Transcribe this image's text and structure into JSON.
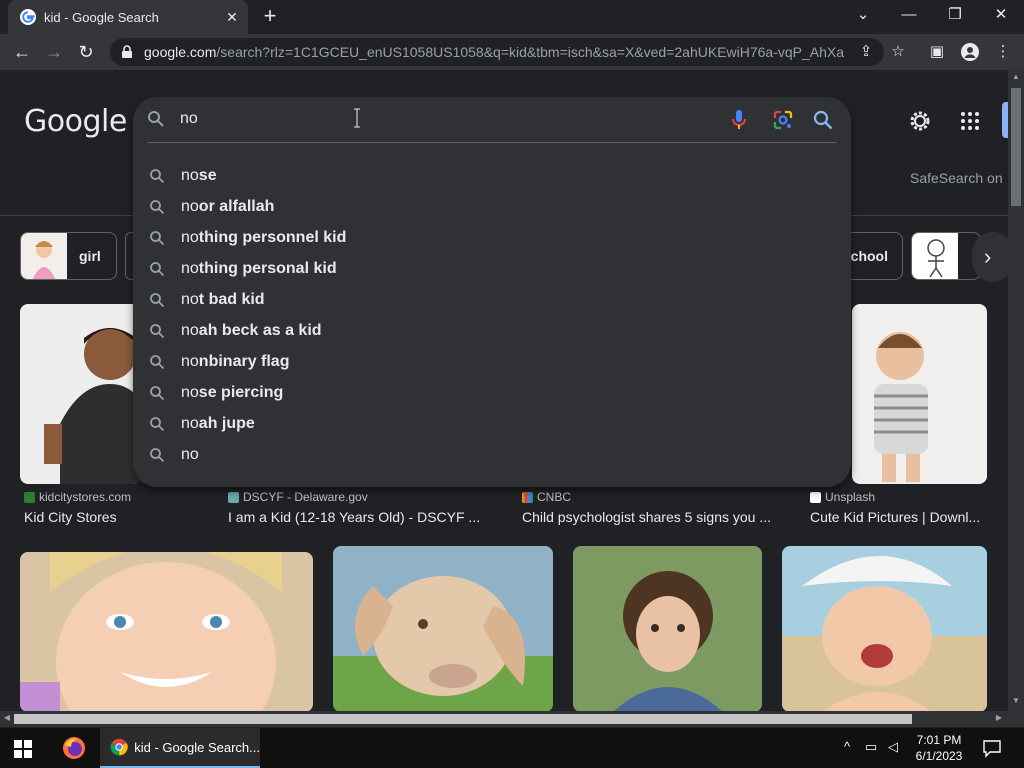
{
  "browser": {
    "tab_title": "kid - Google Search",
    "new_tab_label": "+",
    "url_host": "google.com",
    "url_rest": "/search?rlz=1C1GCEU_enUS1058US1058&q=kid&tbm=isch&sa=X&ved=2ahUKEwiH76a-vqP_AhXaU..."
  },
  "page": {
    "logo": "Google",
    "safesearch": "SafeSearch on",
    "search": {
      "query": "no",
      "suggestions": [
        {
          "typed": "no",
          "rest": "se"
        },
        {
          "typed": "no",
          "rest": "or alfallah"
        },
        {
          "typed": "no",
          "rest": "thing personnel kid"
        },
        {
          "typed": "no",
          "rest": "thing personal kid"
        },
        {
          "typed": "no",
          "rest": "t bad kid"
        },
        {
          "typed": "no",
          "rest": "ah beck as a kid"
        },
        {
          "typed": "no",
          "rest": "nbinary flag"
        },
        {
          "typed": "no",
          "rest": "se piercing"
        },
        {
          "typed": "no",
          "rest": "ah jupe"
        },
        {
          "typed": "no",
          "rest": ""
        }
      ]
    },
    "chips": [
      {
        "label": "girl"
      },
      {
        "label": "school"
      }
    ],
    "results": [
      {
        "source": "kidcitystores.com",
        "title": "Kid City Stores"
      },
      {
        "source": "DSCYF - Delaware.gov",
        "title": "I am a Kid (12-18 Years Old) - DSCYF ..."
      },
      {
        "source": "CNBC",
        "title": "Child psychologist shares 5 signs you ..."
      },
      {
        "source": "Unsplash",
        "title": "Cute Kid Pictures | Downl..."
      }
    ]
  },
  "taskbar": {
    "chrome_label": "kid - Google Search...",
    "time": "7:01 PM",
    "date": "6/1/2023"
  },
  "colors": {
    "background": "#202124",
    "surface": "#303134",
    "accent": "#8ab4f8"
  }
}
